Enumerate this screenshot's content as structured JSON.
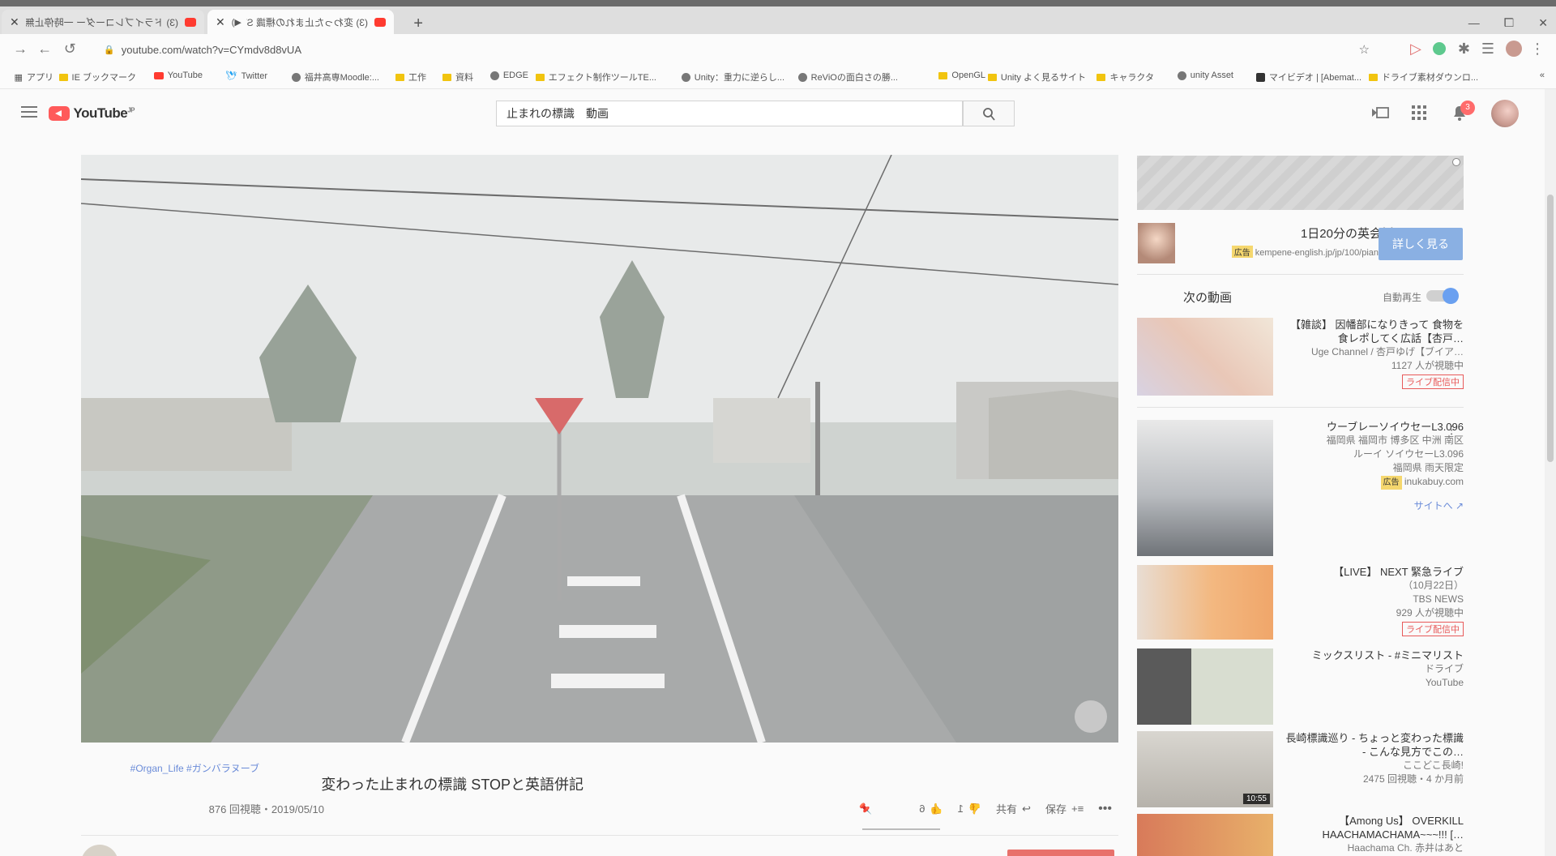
{
  "browser": {
    "tabs": [
      {
        "title": "(3) ドライブレコーダー 一時停止無視 | …"
      },
      {
        "title": "(3) 変わった止まれの標識 STO…"
      }
    ],
    "url": "youtube.com/watch?v=CYmdv8d8vUA",
    "bookmarks": [
      "アプリ",
      "IE ブックマーク",
      "YouTube",
      "Twitter",
      "福井高専Moodle:...",
      "工作",
      "資料",
      "EDGE",
      "エフェクト制作ツールTE...",
      "Unity：重力に逆らし...",
      "ReViOの面白さの勝...",
      "OpenGL",
      "Unity よく見るサイト",
      "キャラクタ",
      "unity Asset",
      "マイビデオ | [Abemat...",
      "ドライブ素材ダウンロ..."
    ]
  },
  "youtube": {
    "search_query": "止まれの標識　動画",
    "notifications_count": "3"
  },
  "video": {
    "tags": "#Organ_Life #ガンバラヌーブ",
    "title": "変わった止まれの標識 STOPと英語併記",
    "views_date": "876 回視聴・2019/05/10",
    "likes": "6",
    "dislikes": "1",
    "share_label": "共有",
    "save_label": "保存"
  },
  "sidebar": {
    "promo": {
      "title": "1日20分の英会話",
      "ad_label": "広告",
      "url": "kempene-english.jp/jp/100/piano-...",
      "button": "詳しく見る"
    },
    "up_next": "次の動画",
    "autoplay": "自動再生",
    "items": [
      {
        "title": "【雑談】 因幡部になりきって 食物を食レポしてく広話【杏戸…",
        "meta1": "Uge Channel / 杏戸ゆげ【ブイア…",
        "meta2": "1127 人が視聴中",
        "badge": "ライブ配信中"
      },
      {
        "title": "ウーブレーソイウセーL3.096",
        "meta1": "福岡県 福岡市 博多区 中洲 南区",
        "meta2": "ルーイ ソイウセーL3.096",
        "meta3": "福岡県 雨天限定",
        "advertiser": "inukabuy.com",
        "ad_label": "広告",
        "site_link": "サイトへ"
      },
      {
        "title": "【LIVE】 NEXT 緊急ライブ",
        "meta1": "（10月22日）",
        "meta2": "TBS NEWS",
        "meta3": "929 人が視聴中",
        "badge": "ライブ配信中"
      },
      {
        "title": "ミックスリスト - #ミニマリスト",
        "meta1": "ドライブ",
        "meta2": "YouTube"
      },
      {
        "title": "長崎標識巡り - ちょっと変わった標識 - こんな見方でこの…",
        "meta1": "ここどこ長崎!",
        "meta2": "2475 回視聴・4 か月前",
        "duration": "10:55"
      },
      {
        "title": "【Among Us】 OVERKILL HAACHAMACHAMA~~~!!! […",
        "meta1": "Haachama Ch. 赤井はあと"
      }
    ]
  }
}
